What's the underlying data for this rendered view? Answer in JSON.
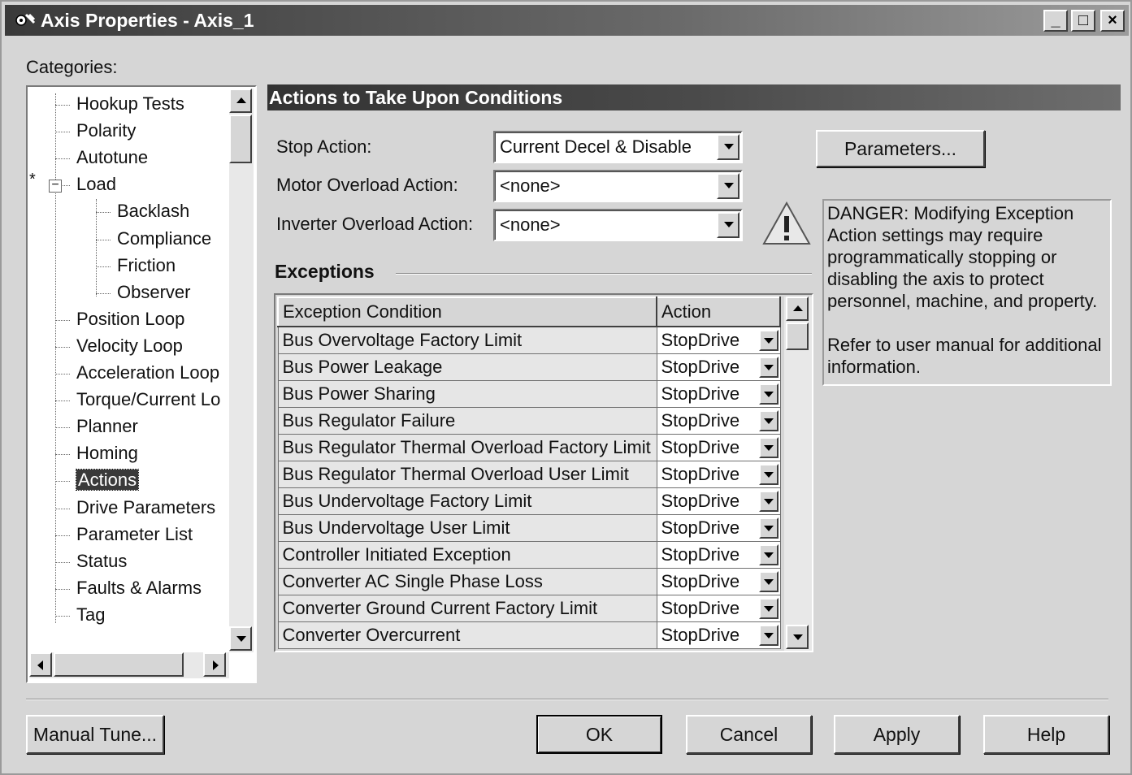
{
  "window": {
    "title": "Axis Properties - Axis_1",
    "controls": {
      "minimize": "_",
      "maximize": "□",
      "close": "×"
    }
  },
  "categories": {
    "label": "Categories:",
    "items": [
      {
        "label": "Hookup Tests",
        "level": 1
      },
      {
        "label": "Polarity",
        "level": 1
      },
      {
        "label": "Autotune",
        "level": 1
      },
      {
        "label": "Load",
        "level": 1,
        "expander": "−",
        "marker": "*"
      },
      {
        "label": "Backlash",
        "level": 2
      },
      {
        "label": "Compliance",
        "level": 2
      },
      {
        "label": "Friction",
        "level": 2
      },
      {
        "label": "Observer",
        "level": 2
      },
      {
        "label": "Position Loop",
        "level": 1
      },
      {
        "label": "Velocity Loop",
        "level": 1
      },
      {
        "label": "Acceleration Loop",
        "level": 1
      },
      {
        "label": "Torque/Current Lo",
        "level": 1
      },
      {
        "label": "Planner",
        "level": 1
      },
      {
        "label": "Homing",
        "level": 1
      },
      {
        "label": "Actions",
        "level": 1,
        "selected": true
      },
      {
        "label": "Drive Parameters",
        "level": 1
      },
      {
        "label": "Parameter List",
        "level": 1
      },
      {
        "label": "Status",
        "level": 1
      },
      {
        "label": "Faults & Alarms",
        "level": 1
      },
      {
        "label": "Tag",
        "level": 1
      }
    ]
  },
  "panel": {
    "header": "Actions to Take Upon Conditions",
    "stop_action": {
      "label": "Stop Action:",
      "value": "Current Decel & Disable"
    },
    "motor_overload": {
      "label": "Motor Overload Action:",
      "value": "<none>"
    },
    "inverter_overload": {
      "label": "Inverter Overload Action:",
      "value": "<none>"
    },
    "parameters_button": "Parameters...",
    "danger_text": "DANGER: Modifying Exception Action settings may require programmatically stopping or disabling the axis to protect personnel, machine, and property.",
    "refer_text": "Refer to user manual for additional information.",
    "exceptions_label": "Exceptions",
    "columns": {
      "condition": "Exception Condition",
      "action": "Action"
    },
    "rows": [
      {
        "condition": "Bus Overvoltage Factory Limit",
        "action": "StopDrive"
      },
      {
        "condition": "Bus Power Leakage",
        "action": "StopDrive"
      },
      {
        "condition": "Bus Power Sharing",
        "action": "StopDrive"
      },
      {
        "condition": "Bus Regulator Failure",
        "action": "StopDrive"
      },
      {
        "condition": "Bus Regulator Thermal Overload Factory Limit",
        "action": "StopDrive"
      },
      {
        "condition": "Bus Regulator Thermal Overload User Limit",
        "action": "StopDrive"
      },
      {
        "condition": "Bus Undervoltage Factory Limit",
        "action": "StopDrive"
      },
      {
        "condition": "Bus Undervoltage User Limit",
        "action": "StopDrive"
      },
      {
        "condition": "Controller Initiated Exception",
        "action": "StopDrive"
      },
      {
        "condition": "Converter AC Single Phase Loss",
        "action": "StopDrive"
      },
      {
        "condition": "Converter Ground Current Factory Limit",
        "action": "StopDrive"
      },
      {
        "condition": "Converter Overcurrent",
        "action": "StopDrive"
      }
    ]
  },
  "footer": {
    "manual_tune": "Manual Tune...",
    "ok": "OK",
    "cancel": "Cancel",
    "apply": "Apply",
    "help": "Help"
  }
}
